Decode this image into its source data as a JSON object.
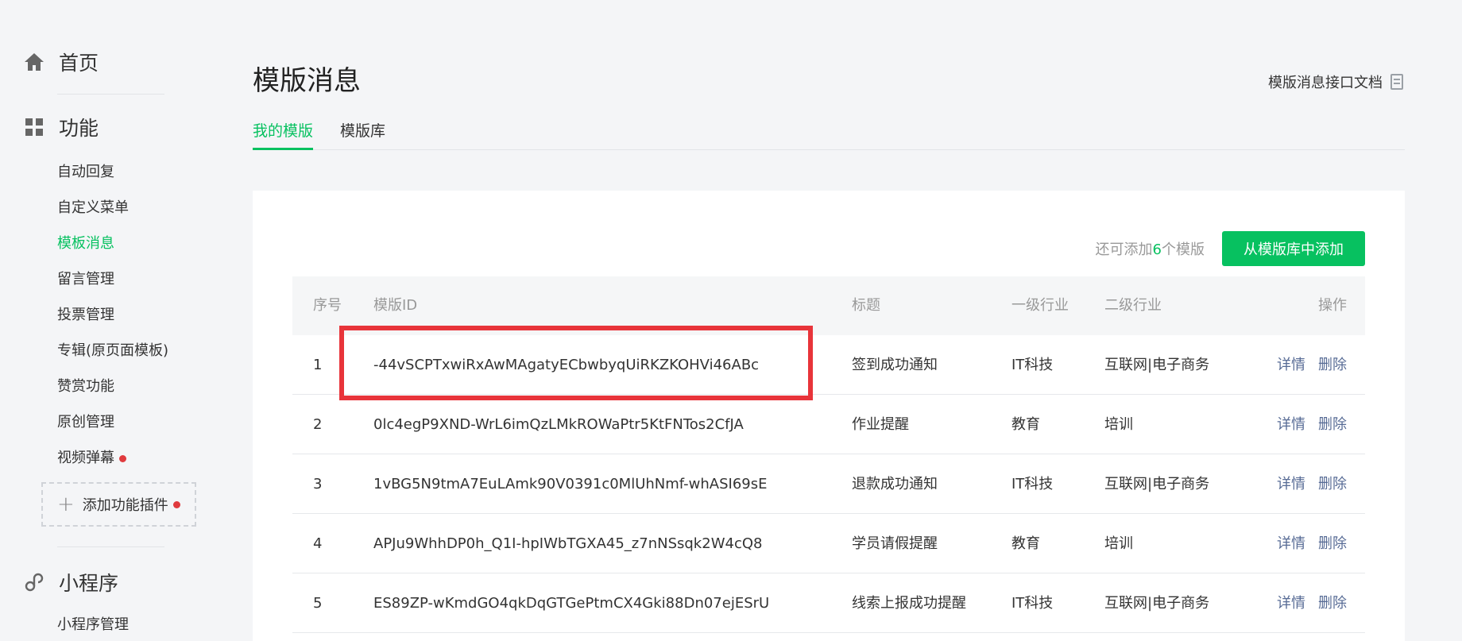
{
  "sidebar": {
    "home_label": "首页",
    "features_label": "功能",
    "items": [
      {
        "label": "自动回复"
      },
      {
        "label": "自定义菜单"
      },
      {
        "label": "模板消息"
      },
      {
        "label": "留言管理"
      },
      {
        "label": "投票管理"
      },
      {
        "label": "专辑(原页面模板)"
      },
      {
        "label": "赞赏功能"
      },
      {
        "label": "原创管理"
      },
      {
        "label": "视频弹幕"
      }
    ],
    "add_plugin_label": "添加功能插件",
    "miniprogram_label": "小程序",
    "miniprogram_manage_label": "小程序管理"
  },
  "header": {
    "title": "模版消息",
    "doc_link": "模版消息接口文档"
  },
  "tabs": [
    {
      "label": "我的模版"
    },
    {
      "label": "模版库"
    }
  ],
  "quota": {
    "prefix": "还可添加",
    "count": "6",
    "suffix": "个模版"
  },
  "add_button_label": "从模版库中添加",
  "table": {
    "headers": {
      "index": "序号",
      "template_id": "模版ID",
      "title": "标题",
      "industry1": "一级行业",
      "industry2": "二级行业",
      "actions": "操作"
    },
    "rows": [
      {
        "index": "1",
        "template_id": "-44vSCPTxwiRxAwMAgatyECbwbyqUiRKZKOHVi46ABc",
        "title": "签到成功通知",
        "industry1": "IT科技",
        "industry2": "互联网|电子商务",
        "detail": "详情",
        "delete": "删除"
      },
      {
        "index": "2",
        "template_id": "0lc4egP9XND-WrL6imQzLMkROWaPtr5KtFNTos2CfJA",
        "title": "作业提醒",
        "industry1": "教育",
        "industry2": "培训",
        "detail": "详情",
        "delete": "删除"
      },
      {
        "index": "3",
        "template_id": "1vBG5N9tmA7EuLAmk90V0391c0MlUhNmf-whASI69sE",
        "title": "退款成功通知",
        "industry1": "IT科技",
        "industry2": "互联网|电子商务",
        "detail": "详情",
        "delete": "删除"
      },
      {
        "index": "4",
        "template_id": "APJu9WhhDP0h_Q1I-hpIWbTGXA45_z7nNSsqk2W4cQ8",
        "title": "学员请假提醒",
        "industry1": "教育",
        "industry2": "培训",
        "detail": "详情",
        "delete": "删除"
      },
      {
        "index": "5",
        "template_id": "ES89ZP-wKmdGO4qkDqGTGePtmCX4Gki88Dn07ejESrU",
        "title": "线索上报成功提醒",
        "industry1": "IT科技",
        "industry2": "互联网|电子商务",
        "detail": "详情",
        "delete": "删除"
      }
    ]
  },
  "colors": {
    "accent_green": "#07c160",
    "link_blue": "#576b95",
    "highlight_red": "#e8343a",
    "badge_red": "#e03a3e"
  },
  "icons": [
    "home-icon",
    "grid-icon",
    "link-icon",
    "plus-icon",
    "document-icon"
  ]
}
